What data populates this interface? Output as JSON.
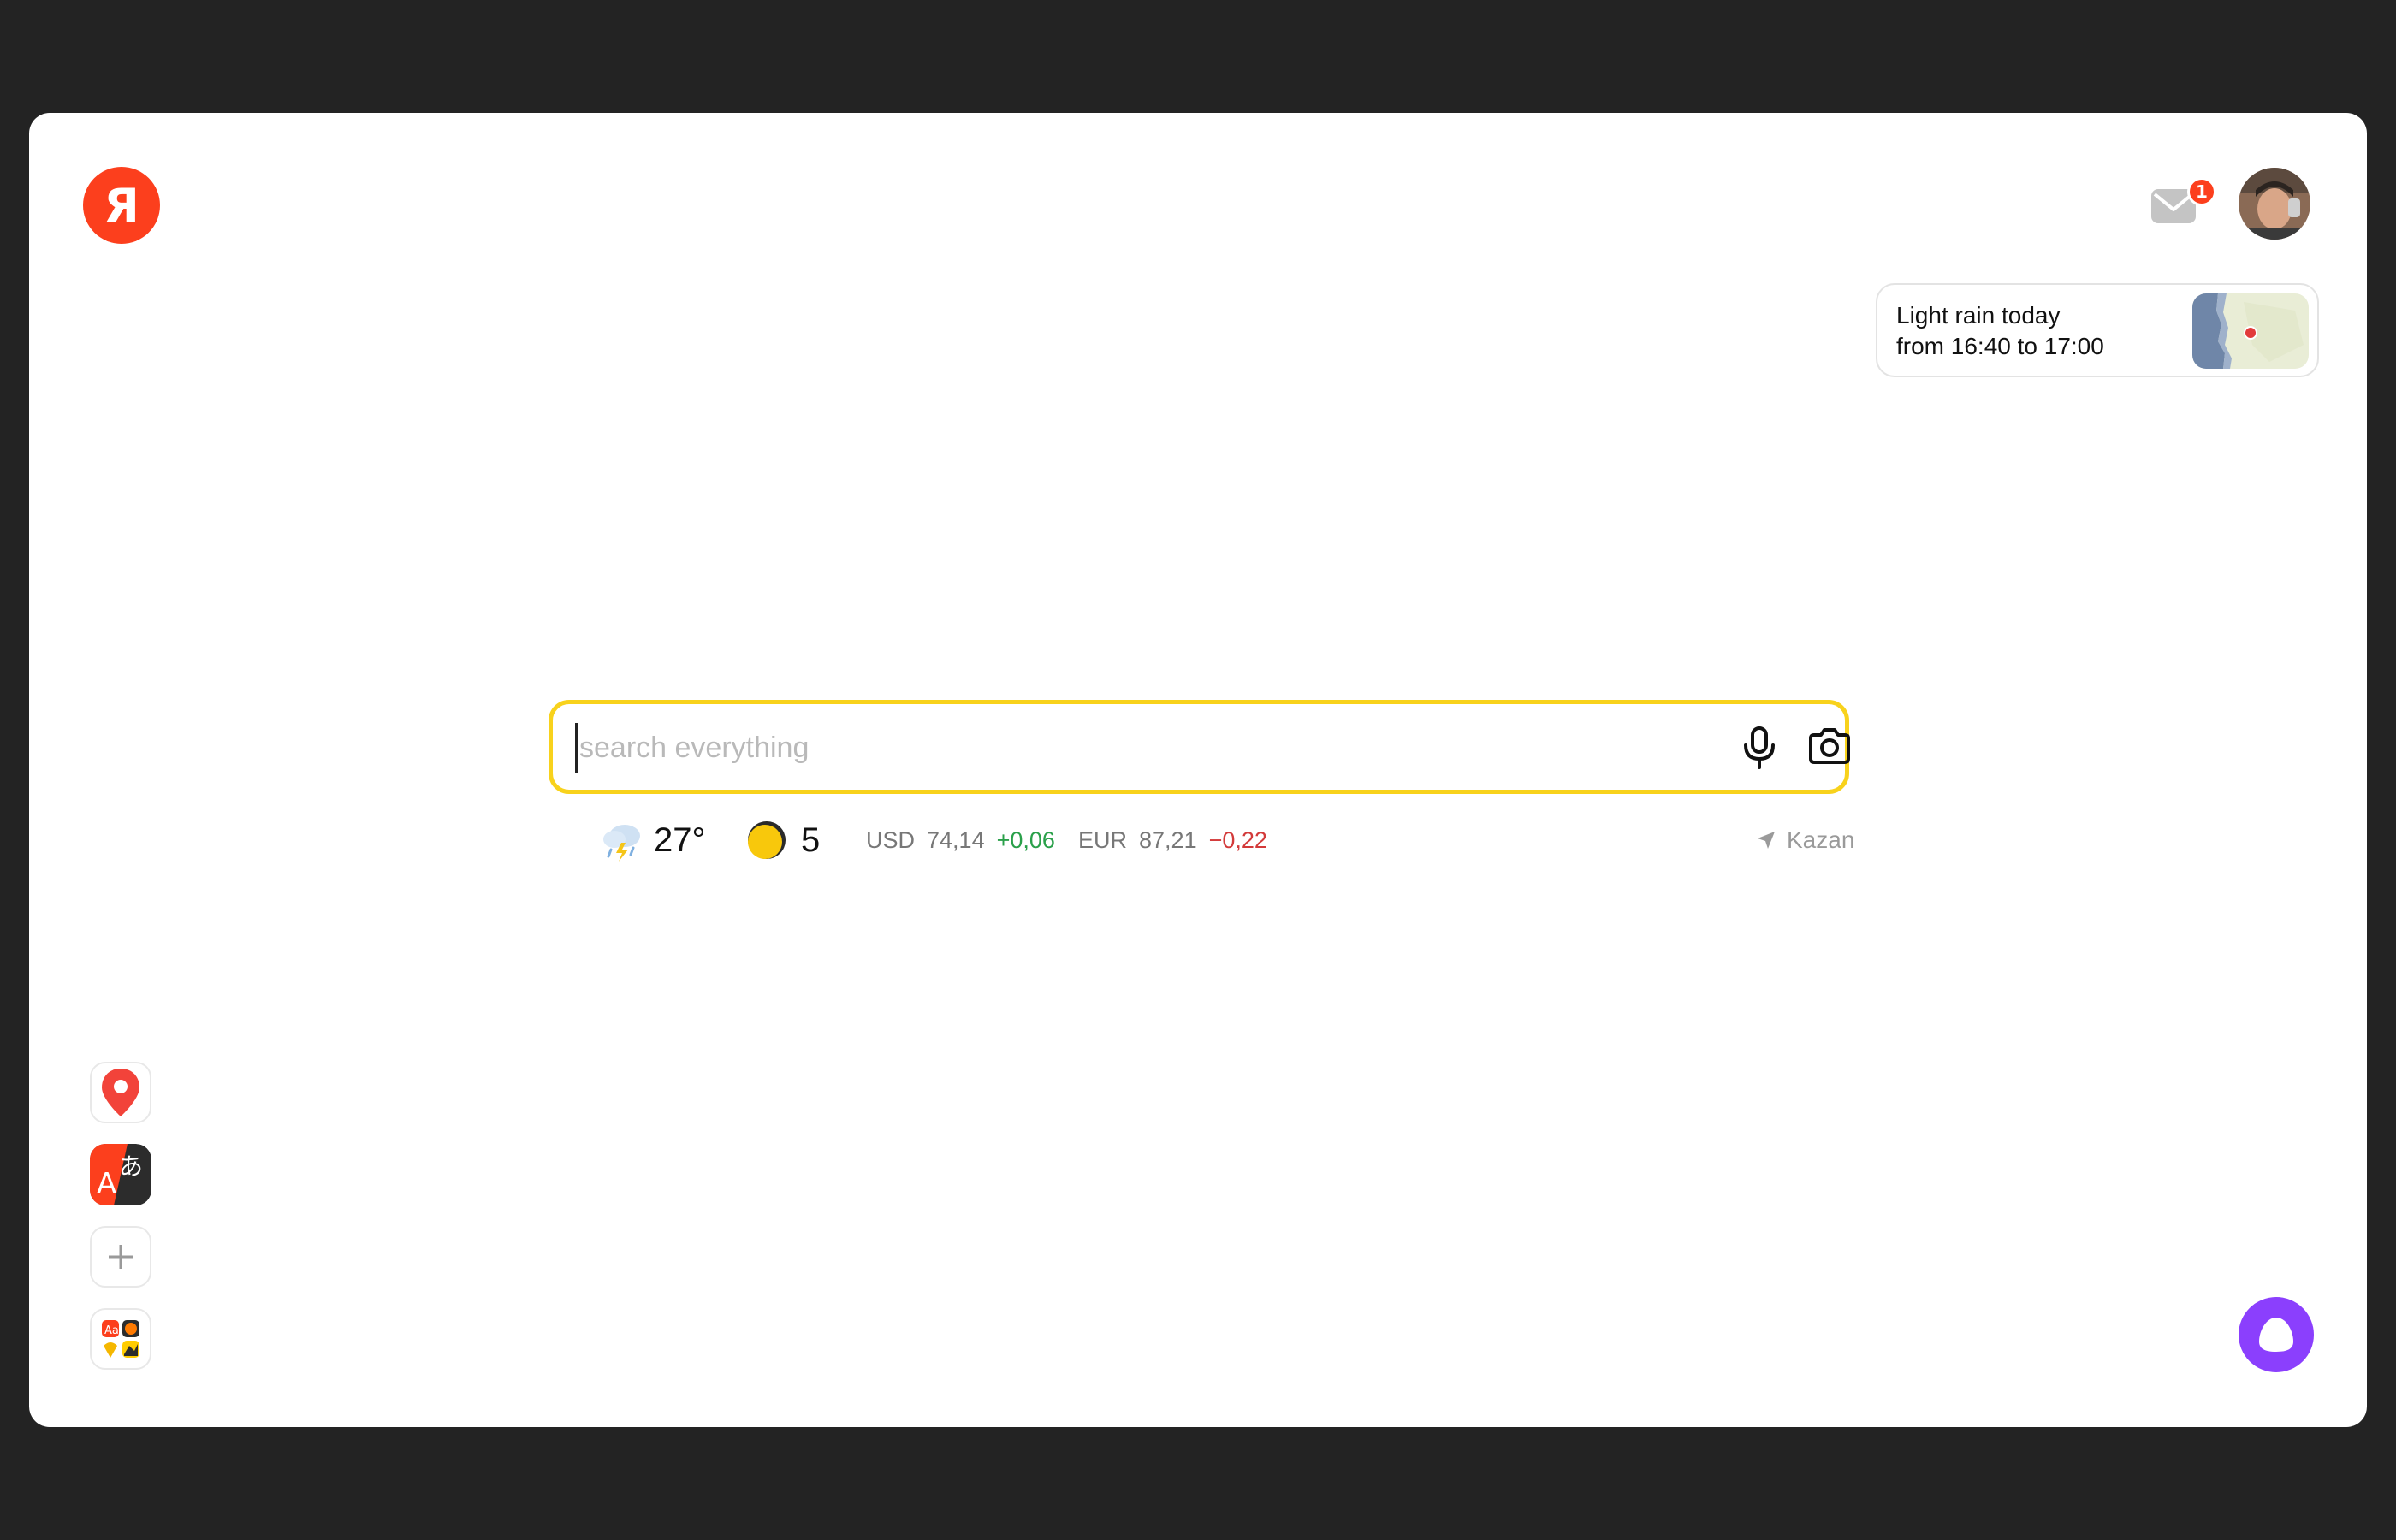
{
  "header": {
    "logo_letter": "Я",
    "mail_badge_count": "1"
  },
  "weather_card": {
    "line1": "Light rain today",
    "line2": "from 16:40 to 17:00"
  },
  "search": {
    "placeholder": "search everything",
    "value": ""
  },
  "info": {
    "temperature": "27°",
    "traffic_score": "5",
    "usd_label": "USD",
    "usd_value": "74,14",
    "usd_change": "+0,06",
    "eur_label": "EUR",
    "eur_value": "87,21",
    "eur_change": "−0,22",
    "city": "Kazan"
  },
  "colors": {
    "brand": "#fc3f1d",
    "search_border": "#f8d21c",
    "alice": "#8b3ffd",
    "positive": "#2aa04a",
    "negative": "#d33a3a"
  },
  "apps": [
    {
      "name": "maps",
      "icon": "map-pin-icon"
    },
    {
      "name": "translate",
      "icon": "translate-icon"
    },
    {
      "name": "add",
      "icon": "plus-icon"
    },
    {
      "name": "all-services",
      "icon": "apps-grid-icon"
    }
  ]
}
